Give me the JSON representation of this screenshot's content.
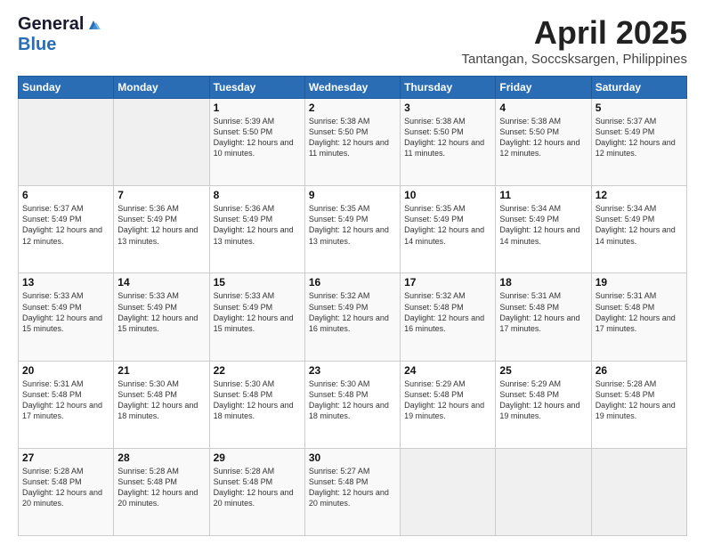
{
  "logo": {
    "general": "General",
    "blue": "Blue"
  },
  "title": "April 2025",
  "location": "Tantangan, Soccsksargen, Philippines",
  "days_of_week": [
    "Sunday",
    "Monday",
    "Tuesday",
    "Wednesday",
    "Thursday",
    "Friday",
    "Saturday"
  ],
  "weeks": [
    [
      {
        "day": "",
        "info": ""
      },
      {
        "day": "",
        "info": ""
      },
      {
        "day": "1",
        "info": "Sunrise: 5:39 AM\nSunset: 5:50 PM\nDaylight: 12 hours and 10 minutes."
      },
      {
        "day": "2",
        "info": "Sunrise: 5:38 AM\nSunset: 5:50 PM\nDaylight: 12 hours and 11 minutes."
      },
      {
        "day": "3",
        "info": "Sunrise: 5:38 AM\nSunset: 5:50 PM\nDaylight: 12 hours and 11 minutes."
      },
      {
        "day": "4",
        "info": "Sunrise: 5:38 AM\nSunset: 5:50 PM\nDaylight: 12 hours and 12 minutes."
      },
      {
        "day": "5",
        "info": "Sunrise: 5:37 AM\nSunset: 5:49 PM\nDaylight: 12 hours and 12 minutes."
      }
    ],
    [
      {
        "day": "6",
        "info": "Sunrise: 5:37 AM\nSunset: 5:49 PM\nDaylight: 12 hours and 12 minutes."
      },
      {
        "day": "7",
        "info": "Sunrise: 5:36 AM\nSunset: 5:49 PM\nDaylight: 12 hours and 13 minutes."
      },
      {
        "day": "8",
        "info": "Sunrise: 5:36 AM\nSunset: 5:49 PM\nDaylight: 12 hours and 13 minutes."
      },
      {
        "day": "9",
        "info": "Sunrise: 5:35 AM\nSunset: 5:49 PM\nDaylight: 12 hours and 13 minutes."
      },
      {
        "day": "10",
        "info": "Sunrise: 5:35 AM\nSunset: 5:49 PM\nDaylight: 12 hours and 14 minutes."
      },
      {
        "day": "11",
        "info": "Sunrise: 5:34 AM\nSunset: 5:49 PM\nDaylight: 12 hours and 14 minutes."
      },
      {
        "day": "12",
        "info": "Sunrise: 5:34 AM\nSunset: 5:49 PM\nDaylight: 12 hours and 14 minutes."
      }
    ],
    [
      {
        "day": "13",
        "info": "Sunrise: 5:33 AM\nSunset: 5:49 PM\nDaylight: 12 hours and 15 minutes."
      },
      {
        "day": "14",
        "info": "Sunrise: 5:33 AM\nSunset: 5:49 PM\nDaylight: 12 hours and 15 minutes."
      },
      {
        "day": "15",
        "info": "Sunrise: 5:33 AM\nSunset: 5:49 PM\nDaylight: 12 hours and 15 minutes."
      },
      {
        "day": "16",
        "info": "Sunrise: 5:32 AM\nSunset: 5:49 PM\nDaylight: 12 hours and 16 minutes."
      },
      {
        "day": "17",
        "info": "Sunrise: 5:32 AM\nSunset: 5:48 PM\nDaylight: 12 hours and 16 minutes."
      },
      {
        "day": "18",
        "info": "Sunrise: 5:31 AM\nSunset: 5:48 PM\nDaylight: 12 hours and 17 minutes."
      },
      {
        "day": "19",
        "info": "Sunrise: 5:31 AM\nSunset: 5:48 PM\nDaylight: 12 hours and 17 minutes."
      }
    ],
    [
      {
        "day": "20",
        "info": "Sunrise: 5:31 AM\nSunset: 5:48 PM\nDaylight: 12 hours and 17 minutes."
      },
      {
        "day": "21",
        "info": "Sunrise: 5:30 AM\nSunset: 5:48 PM\nDaylight: 12 hours and 18 minutes."
      },
      {
        "day": "22",
        "info": "Sunrise: 5:30 AM\nSunset: 5:48 PM\nDaylight: 12 hours and 18 minutes."
      },
      {
        "day": "23",
        "info": "Sunrise: 5:30 AM\nSunset: 5:48 PM\nDaylight: 12 hours and 18 minutes."
      },
      {
        "day": "24",
        "info": "Sunrise: 5:29 AM\nSunset: 5:48 PM\nDaylight: 12 hours and 19 minutes."
      },
      {
        "day": "25",
        "info": "Sunrise: 5:29 AM\nSunset: 5:48 PM\nDaylight: 12 hours and 19 minutes."
      },
      {
        "day": "26",
        "info": "Sunrise: 5:28 AM\nSunset: 5:48 PM\nDaylight: 12 hours and 19 minutes."
      }
    ],
    [
      {
        "day": "27",
        "info": "Sunrise: 5:28 AM\nSunset: 5:48 PM\nDaylight: 12 hours and 20 minutes."
      },
      {
        "day": "28",
        "info": "Sunrise: 5:28 AM\nSunset: 5:48 PM\nDaylight: 12 hours and 20 minutes."
      },
      {
        "day": "29",
        "info": "Sunrise: 5:28 AM\nSunset: 5:48 PM\nDaylight: 12 hours and 20 minutes."
      },
      {
        "day": "30",
        "info": "Sunrise: 5:27 AM\nSunset: 5:48 PM\nDaylight: 12 hours and 20 minutes."
      },
      {
        "day": "",
        "info": ""
      },
      {
        "day": "",
        "info": ""
      },
      {
        "day": "",
        "info": ""
      }
    ]
  ]
}
